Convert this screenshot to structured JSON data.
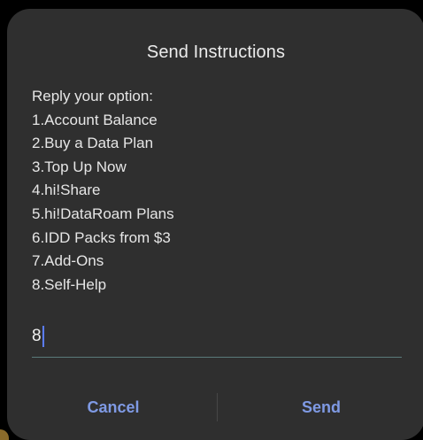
{
  "dialog": {
    "title": "Send Instructions",
    "message_lines": [
      "Reply your option:",
      "1.Account Balance",
      "2.Buy a Data Plan",
      "3.Top Up Now",
      "4.hi!Share",
      "5.hi!DataRoam Plans",
      "6.IDD Packs from $3",
      "7.Add-Ons",
      "8.Self-Help"
    ],
    "reply": {
      "value": "8",
      "placeholder": ""
    },
    "buttons": {
      "cancel_label": "Cancel",
      "send_label": "Send"
    }
  },
  "colors": {
    "dialog_background": "#2f2f2f",
    "accent": "#7f9ae4",
    "caret": "#5b7cff",
    "text": "#e6e6e6",
    "underline": "#5a7b7b"
  },
  "icons": {
    "text_cursor": "text-cursor-icon"
  }
}
